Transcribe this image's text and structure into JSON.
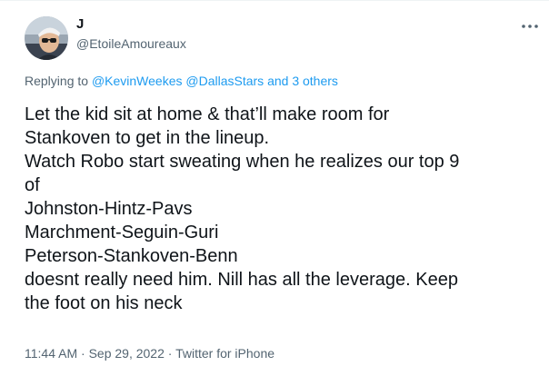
{
  "author": {
    "display_name": "J",
    "handle": "@EtoileAmoureaux"
  },
  "more_icon": "more-horizontal-icon",
  "reply_context": {
    "prefix": "Replying to",
    "mention_1": "@KevinWeekes",
    "mention_2": "@DallasStars",
    "connector": "and",
    "others": "3 others"
  },
  "body_lines": [
    "Let the kid sit at home & that’ll make room for",
    "Stankoven to get in the lineup.",
    "Watch Robo start sweating when he realizes our top 9",
    "of",
    "Johnston-Hintz-Pavs",
    "Marchment-Seguin-Guri",
    "Peterson-Stankoven-Benn",
    "doesnt really need him. Nill has all the leverage. Keep",
    "the foot on his neck"
  ],
  "meta": {
    "time": "11:44 AM",
    "separator": "·",
    "date": "Sep 29, 2022",
    "source": "Twitter for iPhone"
  }
}
